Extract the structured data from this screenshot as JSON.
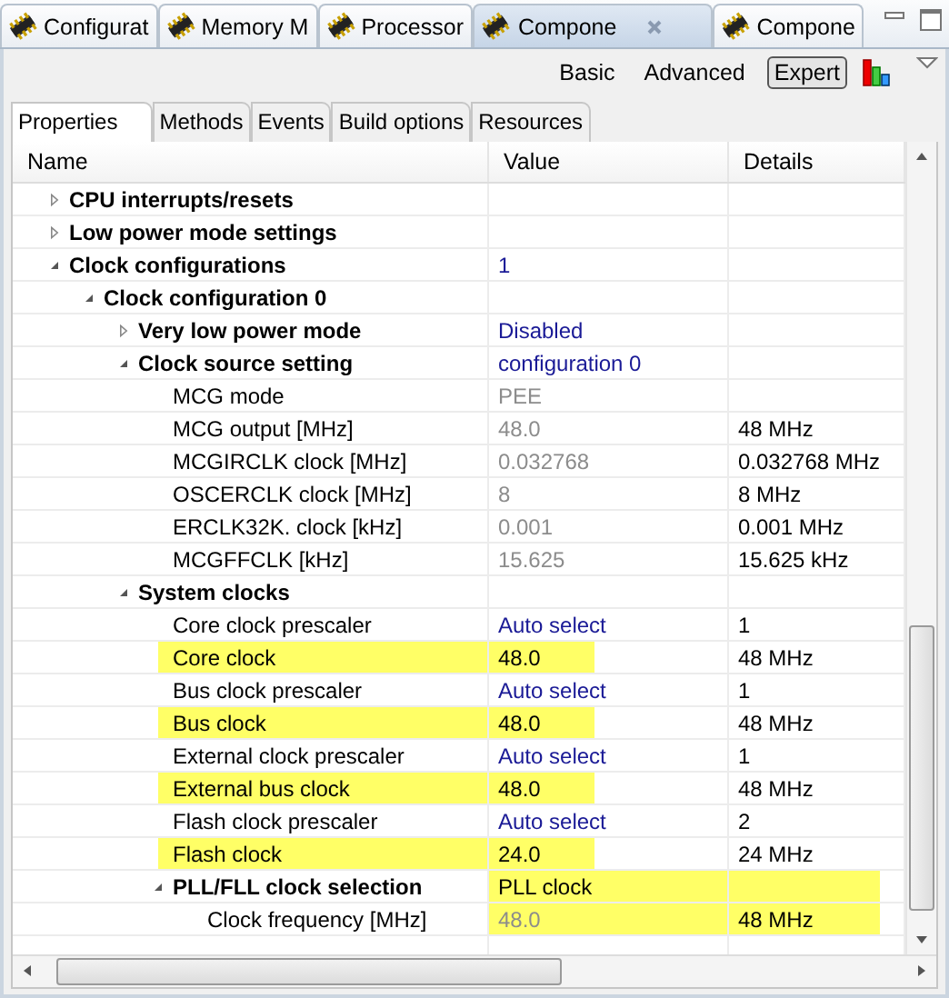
{
  "editor_tabs": [
    {
      "label": "Configurat",
      "selected": false
    },
    {
      "label": "Memory M",
      "selected": false
    },
    {
      "label": "Processor",
      "selected": false
    },
    {
      "label": "Compone",
      "selected": true
    },
    {
      "label": "Compone",
      "selected": false
    }
  ],
  "view_modes": [
    {
      "label": "Basic",
      "selected": false
    },
    {
      "label": "Advanced",
      "selected": false
    },
    {
      "label": "Expert",
      "selected": true
    }
  ],
  "inner_tabs": [
    {
      "label": "Properties",
      "selected": true
    },
    {
      "label": "Methods",
      "selected": false
    },
    {
      "label": "Events",
      "selected": false
    },
    {
      "label": "Build options",
      "selected": false
    },
    {
      "label": "Resources",
      "selected": false
    }
  ],
  "table": {
    "columns": [
      "Name",
      "Value",
      "Details"
    ],
    "rows": [
      {
        "name": "CPU interrupts/resets",
        "kind": "group",
        "expanded": false,
        "highlighted": false
      },
      {
        "name": "Low power mode settings",
        "kind": "group",
        "expanded": false,
        "highlighted": false
      },
      {
        "name": "Clock configurations",
        "kind": "group",
        "expanded": true,
        "highlighted": false,
        "value": {
          "text": "1",
          "kind": "editable",
          "highlighted": false
        },
        "children": [
          {
            "name": "Clock configuration 0",
            "kind": "group",
            "expanded": true,
            "highlighted": false,
            "children": [
              {
                "name": "Very low power mode",
                "kind": "group",
                "expanded": false,
                "highlighted": false,
                "value": {
                  "text": "Disabled",
                  "kind": "editable",
                  "highlighted": false
                }
              },
              {
                "name": "Clock source setting",
                "kind": "group",
                "expanded": true,
                "highlighted": false,
                "value": {
                  "text": "configuration 0",
                  "kind": "editable",
                  "highlighted": false
                },
                "children": [
                  {
                    "name": "MCG mode",
                    "kind": "leaf",
                    "highlighted": false,
                    "value": {
                      "text": "PEE",
                      "kind": "readonly",
                      "highlighted": false
                    }
                  },
                  {
                    "name": "MCG output [MHz]",
                    "kind": "leaf",
                    "highlighted": false,
                    "value": {
                      "text": "48.0",
                      "kind": "readonly",
                      "highlighted": false
                    },
                    "details": {
                      "text": "48 MHz",
                      "highlighted": false
                    }
                  },
                  {
                    "name": "MCGIRCLK clock [MHz]",
                    "kind": "leaf",
                    "highlighted": false,
                    "value": {
                      "text": "0.032768",
                      "kind": "readonly",
                      "highlighted": false
                    },
                    "details": {
                      "text": "0.032768 MHz",
                      "highlighted": false
                    }
                  },
                  {
                    "name": "OSCERCLK clock [MHz]",
                    "kind": "leaf",
                    "highlighted": false,
                    "value": {
                      "text": "8",
                      "kind": "readonly",
                      "highlighted": false
                    },
                    "details": {
                      "text": "8 MHz",
                      "highlighted": false
                    }
                  },
                  {
                    "name": "ERCLK32K. clock [kHz]",
                    "kind": "leaf",
                    "highlighted": false,
                    "value": {
                      "text": "0.001",
                      "kind": "readonly",
                      "highlighted": false
                    },
                    "details": {
                      "text": "0.001 MHz",
                      "highlighted": false
                    }
                  },
                  {
                    "name": "MCGFFCLK [kHz]",
                    "kind": "leaf",
                    "highlighted": false,
                    "value": {
                      "text": "15.625",
                      "kind": "readonly",
                      "highlighted": false
                    },
                    "details": {
                      "text": "15.625 kHz",
                      "highlighted": false
                    }
                  }
                ]
              },
              {
                "name": "System clocks",
                "kind": "group",
                "expanded": true,
                "highlighted": false,
                "children": [
                  {
                    "name": "Core clock prescaler",
                    "kind": "leaf",
                    "highlighted": false,
                    "value": {
                      "text": "Auto select",
                      "kind": "editable",
                      "highlighted": false
                    },
                    "details": {
                      "text": "1",
                      "highlighted": false
                    }
                  },
                  {
                    "name": "Core clock",
                    "kind": "leaf",
                    "highlighted": true,
                    "value": {
                      "text": "48.0",
                      "kind": "plain",
                      "highlighted": true
                    },
                    "details": {
                      "text": "48 MHz",
                      "highlighted": false
                    }
                  },
                  {
                    "name": "Bus clock prescaler",
                    "kind": "leaf",
                    "highlighted": false,
                    "value": {
                      "text": "Auto select",
                      "kind": "editable",
                      "highlighted": false
                    },
                    "details": {
                      "text": "1",
                      "highlighted": false
                    }
                  },
                  {
                    "name": "Bus clock",
                    "kind": "leaf",
                    "highlighted": true,
                    "value": {
                      "text": "48.0",
                      "kind": "plain",
                      "highlighted": true
                    },
                    "details": {
                      "text": "48 MHz",
                      "highlighted": false
                    }
                  },
                  {
                    "name": "External clock prescaler",
                    "kind": "leaf",
                    "highlighted": false,
                    "value": {
                      "text": "Auto select",
                      "kind": "editable",
                      "highlighted": false
                    },
                    "details": {
                      "text": "1",
                      "highlighted": false
                    }
                  },
                  {
                    "name": "External bus clock",
                    "kind": "leaf",
                    "highlighted": true,
                    "value": {
                      "text": "48.0",
                      "kind": "plain",
                      "highlighted": true
                    },
                    "details": {
                      "text": "48 MHz",
                      "highlighted": false
                    }
                  },
                  {
                    "name": "Flash clock prescaler",
                    "kind": "leaf",
                    "highlighted": false,
                    "value": {
                      "text": "Auto select",
                      "kind": "editable",
                      "highlighted": false
                    },
                    "details": {
                      "text": "2",
                      "highlighted": false
                    }
                  },
                  {
                    "name": "Flash clock",
                    "kind": "leaf",
                    "highlighted": true,
                    "value": {
                      "text": "24.0",
                      "kind": "plain",
                      "highlighted": true
                    },
                    "details": {
                      "text": "24 MHz",
                      "highlighted": false
                    }
                  },
                  {
                    "name": "PLL/FLL clock selection",
                    "kind": "group",
                    "expanded": true,
                    "highlighted": false,
                    "value": {
                      "text": "PLL clock",
                      "kind": "plain",
                      "highlighted": true
                    },
                    "details": {
                      "highlighted": true
                    },
                    "children": [
                      {
                        "name": "Clock frequency [MHz]",
                        "kind": "leaf",
                        "highlighted": false,
                        "value": {
                          "text": "48.0",
                          "kind": "readonly",
                          "highlighted": true
                        },
                        "details": {
                          "text": "48 MHz",
                          "highlighted": true
                        }
                      }
                    ]
                  }
                ]
              }
            ]
          }
        ]
      }
    ]
  }
}
